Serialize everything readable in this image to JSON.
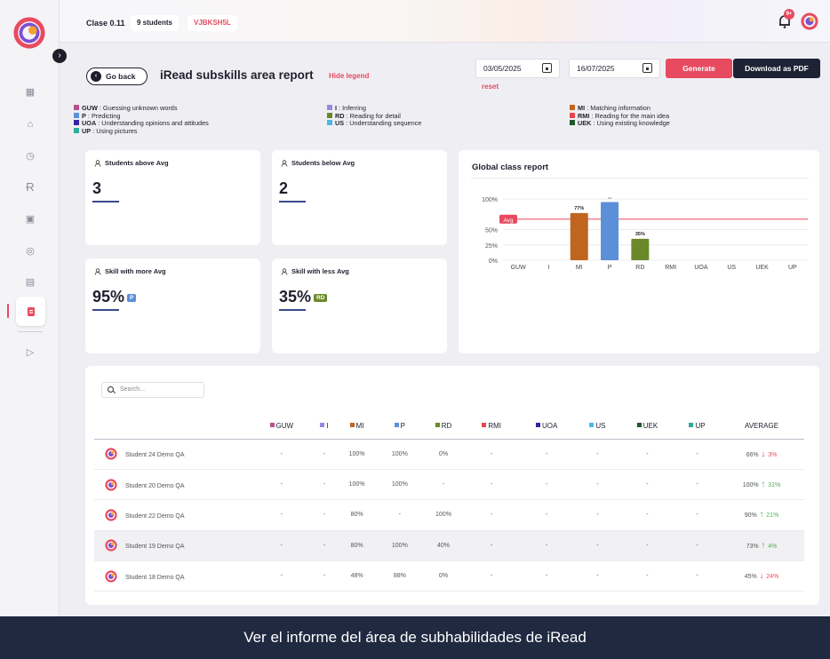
{
  "topbar": {
    "class_name": "Clase 0.11",
    "students_pill": "9 students",
    "code_pill": "VJBKSH5L",
    "notif_badge": "9+"
  },
  "header": {
    "go_back": "Go back",
    "title": "iRead subskills area report",
    "hide_legend": "Hide legend",
    "date_from": "03/05/2025",
    "date_to": "16/07/2025",
    "reset": "reset",
    "generate": "Generate",
    "download_pdf": "Download as PDF"
  },
  "legend": [
    {
      "code": "GUW",
      "desc": " : Guessing unknown words",
      "color": "#b8508e"
    },
    {
      "code": "P",
      "desc": " : Predicting",
      "color": "#5b8fd8"
    },
    {
      "code": "UOA",
      "desc": " : Understanding opinions and attitudes",
      "color": "#3b1fa3"
    },
    {
      "code": "UP",
      "desc": " : Using pictures",
      "color": "#2eab9e"
    },
    {
      "code": "I",
      "desc": " : Inferring",
      "color": "#9a88e0"
    },
    {
      "code": "RD",
      "desc": " : Reading for detail",
      "color": "#6a8a2a"
    },
    {
      "code": "US",
      "desc": " : Understanding sequence",
      "color": "#4ab8e8"
    },
    {
      "code": "MI",
      "desc": " : Matching information",
      "color": "#c06520"
    },
    {
      "code": "RMI",
      "desc": " : Reading for the main idea",
      "color": "#e8454f"
    },
    {
      "code": "UEK",
      "desc": " : Using existing knowledge",
      "color": "#1f5a2a"
    }
  ],
  "stats": {
    "above": {
      "title": "Students above Avg",
      "value": "3"
    },
    "below": {
      "title": "Students below Avg",
      "value": "2"
    },
    "more": {
      "title": "Skill with more Avg",
      "value": "95%",
      "tag": "P",
      "tag_color": "#5b8fd8"
    },
    "less": {
      "title": "Skill with less Avg",
      "value": "35%",
      "tag": "RD",
      "tag_color": "#6a8a2a"
    }
  },
  "chart_data": {
    "type": "bar",
    "title": "Global class report",
    "categories": [
      "GUW",
      "I",
      "MI",
      "P",
      "RD",
      "RMI",
      "UOA",
      "US",
      "UEK",
      "UP"
    ],
    "values": [
      null,
      null,
      77,
      95,
      35,
      null,
      null,
      null,
      null,
      null
    ],
    "data_labels": [
      "",
      "",
      "77%",
      "...",
      "35%",
      "",
      "",
      "",
      "",
      ""
    ],
    "bar_colors": [
      "#b8508e",
      "#9a88e0",
      "#c06520",
      "#5b8fd8",
      "#6a8a2a",
      "#e8454f",
      "#3b1fa3",
      "#4ab8e8",
      "#1f5a2a",
      "#2eab9e"
    ],
    "ylim": [
      0,
      100
    ],
    "yticks": [
      "0%",
      "25%",
      "50%",
      "Avg",
      "100%"
    ],
    "avg_label": "Avg",
    "avg_value": 67,
    "grid": true
  },
  "table": {
    "search_placeholder": "Search...",
    "columns": [
      {
        "label": "GUW",
        "color": "#b8508e"
      },
      {
        "label": "I",
        "color": "#9a88e0"
      },
      {
        "label": "MI",
        "color": "#c06520"
      },
      {
        "label": "P",
        "color": "#5b8fd8"
      },
      {
        "label": "RD",
        "color": "#6a8a2a"
      },
      {
        "label": "RMI",
        "color": "#e8454f"
      },
      {
        "label": "UOA",
        "color": "#3b1fa3"
      },
      {
        "label": "US",
        "color": "#4ab8e8"
      },
      {
        "label": "UEK",
        "color": "#1f5a2a"
      },
      {
        "label": "UP",
        "color": "#2eab9e"
      }
    ],
    "average_header": "AVERAGE",
    "rows": [
      {
        "name": "Student 24 Demo QA",
        "values": [
          "-",
          "-",
          "100%",
          "100%",
          "0%",
          "-",
          "-",
          "-",
          "-",
          "-"
        ],
        "avg": "66%",
        "delta": "3%",
        "dir": "down"
      },
      {
        "name": "Student 20 Demo QA",
        "values": [
          "-",
          "-",
          "100%",
          "100%",
          "-",
          "-",
          "-",
          "-",
          "-",
          "-"
        ],
        "avg": "100%",
        "delta": "31%",
        "dir": "up"
      },
      {
        "name": "Student 22 Demo QA",
        "values": [
          "-",
          "-",
          "80%",
          "-",
          "100%",
          "-",
          "-",
          "-",
          "-",
          "-"
        ],
        "avg": "90%",
        "delta": "21%",
        "dir": "up"
      },
      {
        "name": "Student 19 Demo QA",
        "values": [
          "-",
          "-",
          "80%",
          "100%",
          "40%",
          "-",
          "-",
          "-",
          "-",
          "-"
        ],
        "avg": "73%",
        "delta": "4%",
        "dir": "up"
      },
      {
        "name": "Student 18 Demo QA",
        "values": [
          "-",
          "-",
          "48%",
          "88%",
          "0%",
          "-",
          "-",
          "-",
          "-",
          "-"
        ],
        "avg": "45%",
        "delta": "24%",
        "dir": "down"
      }
    ]
  },
  "caption": "Ver el informe del área de subhabilidades de iRead"
}
